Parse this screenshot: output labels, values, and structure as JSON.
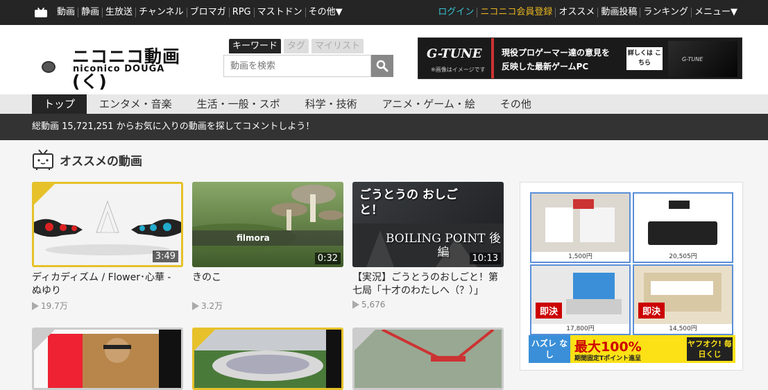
{
  "topbar": {
    "left_links": [
      "動画",
      "静画",
      "生放送",
      "チャンネル",
      "ブロマガ",
      "RPG",
      "マストドン",
      "その他▼"
    ],
    "login": "ログイン",
    "premium": "ニコニコ会員登録",
    "right_links": [
      "オススメ",
      "動画投稿",
      "ランキング",
      "メニュー▼"
    ]
  },
  "header": {
    "logo_main": "ニコニコ動画(く)",
    "logo_sub": "niconico DOUGA",
    "search_tabs": [
      "キーワード",
      "タグ",
      "マイリスト"
    ],
    "search_placeholder": "動画を検索"
  },
  "banner": {
    "brand": "G-TUNE",
    "note": "※画像はイメージです",
    "line1": "現役プロゲーマー達の意見を",
    "line2": "反映した最新ゲームPC",
    "detail": "詳しくは こちら",
    "laptop_brand": "G-TUNE"
  },
  "catnav": [
    "トップ",
    "エンタメ・音楽",
    "生活・一般・スポ",
    "科学・技術",
    "アニメ・ゲーム・絵",
    "その他"
  ],
  "infobar": "総動画 15,721,251 からお気に入りの動画を探してコメントしよう！",
  "section_title": "オススメの動画",
  "videos": [
    {
      "title": "ディカディズム / Flower･心華 - ぬゆり",
      "duration": "3:49",
      "views": "19.7万"
    },
    {
      "title": "きのこ",
      "duration": "0:32",
      "views": "3.2万",
      "overlay": "filmora"
    },
    {
      "title": "【実況】ごうとうのおしごと！第七局「十才のわたしへ（？）」",
      "duration": "10:13",
      "views": "5,676",
      "overlay1": "ごうとうの おしごと！",
      "overlay2": "BOILING POINT 後編"
    }
  ],
  "ad": {
    "prices": [
      "1,500円",
      "20,505円",
      "17,800円",
      "14,500円"
    ],
    "sold_label": "即決",
    "promo_left": "ハズレ なし",
    "promo_mid": "最大100%",
    "promo_mid2": "期間固定Tポイント進呈",
    "promo_right": "ヤフオク! 毎日くじ"
  },
  "colors": {
    "topbar_bg": "#252525",
    "login": "#37c2d3",
    "premium": "#e6b422",
    "ribbon_gold": "#e6c12a"
  }
}
